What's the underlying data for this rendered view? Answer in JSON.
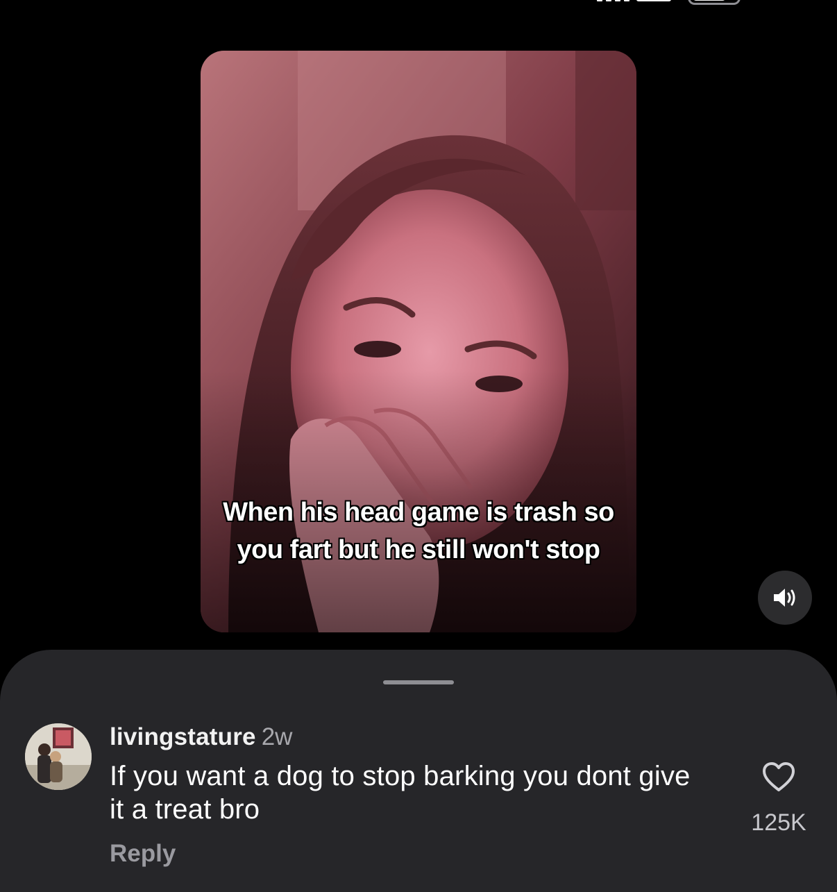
{
  "video": {
    "caption": "When his head game is trash so you fart but he still won't stop",
    "sound_icon": "speaker-volume-icon"
  },
  "comment": {
    "username": "livingstature",
    "timestamp": "2w",
    "text": "If you want a dog to stop barking you dont give it a treat bro",
    "reply_label": "Reply",
    "like_count": "125K",
    "like_icon": "heart-outline-icon"
  },
  "colors": {
    "background": "#000000",
    "sheet": "#262629",
    "secondary_text": "#a8a8ad"
  }
}
